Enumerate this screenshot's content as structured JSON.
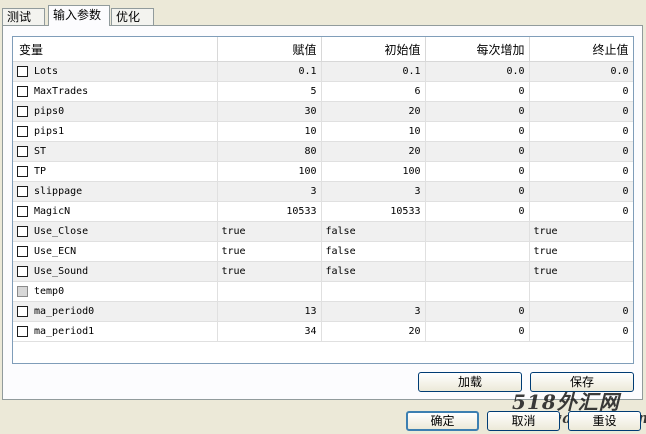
{
  "tabs": [
    {
      "label": "测试"
    },
    {
      "label": "输入参数"
    },
    {
      "label": "优化"
    }
  ],
  "active_tab": 1,
  "columns": [
    "变量",
    "赋值",
    "初始值",
    "每次增加",
    "终止值"
  ],
  "rows": [
    {
      "name": "Lots",
      "value": "0.1",
      "start": "0.1",
      "step": "0.0",
      "stop": "0.0",
      "type": "num"
    },
    {
      "name": "MaxTrades",
      "value": "5",
      "start": "6",
      "step": "0",
      "stop": "0",
      "type": "num"
    },
    {
      "name": "pips0",
      "value": "30",
      "start": "20",
      "step": "0",
      "stop": "0",
      "type": "num"
    },
    {
      "name": "pips1",
      "value": "10",
      "start": "10",
      "step": "0",
      "stop": "0",
      "type": "num"
    },
    {
      "name": "ST",
      "value": "80",
      "start": "20",
      "step": "0",
      "stop": "0",
      "type": "num"
    },
    {
      "name": "TP",
      "value": "100",
      "start": "100",
      "step": "0",
      "stop": "0",
      "type": "num"
    },
    {
      "name": "slippage",
      "value": "3",
      "start": "3",
      "step": "0",
      "stop": "0",
      "type": "num"
    },
    {
      "name": "MagicN",
      "value": "10533",
      "start": "10533",
      "step": "0",
      "stop": "0",
      "type": "num"
    },
    {
      "name": "Use_Close",
      "value": "true",
      "start": "false",
      "step": "",
      "stop": "true",
      "type": "txt"
    },
    {
      "name": "Use_ECN",
      "value": "true",
      "start": "false",
      "step": "",
      "stop": "true",
      "type": "txt"
    },
    {
      "name": "Use_Sound",
      "value": "true",
      "start": "false",
      "step": "",
      "stop": "true",
      "type": "txt"
    },
    {
      "name": "temp0",
      "value": "",
      "start": "",
      "step": "",
      "stop": "",
      "type": "txt",
      "disabled": true
    },
    {
      "name": "ma_period0",
      "value": "13",
      "start": "3",
      "step": "0",
      "stop": "0",
      "type": "num"
    },
    {
      "name": "ma_period1",
      "value": "34",
      "start": "20",
      "step": "0",
      "stop": "0",
      "type": "num"
    }
  ],
  "buttons": {
    "load": "加载",
    "save": "保存",
    "ok": "确定",
    "cancel": "取消",
    "reset": "重设"
  },
  "watermark": {
    "line1": "518外汇网",
    "line2": "518waihui.com"
  }
}
